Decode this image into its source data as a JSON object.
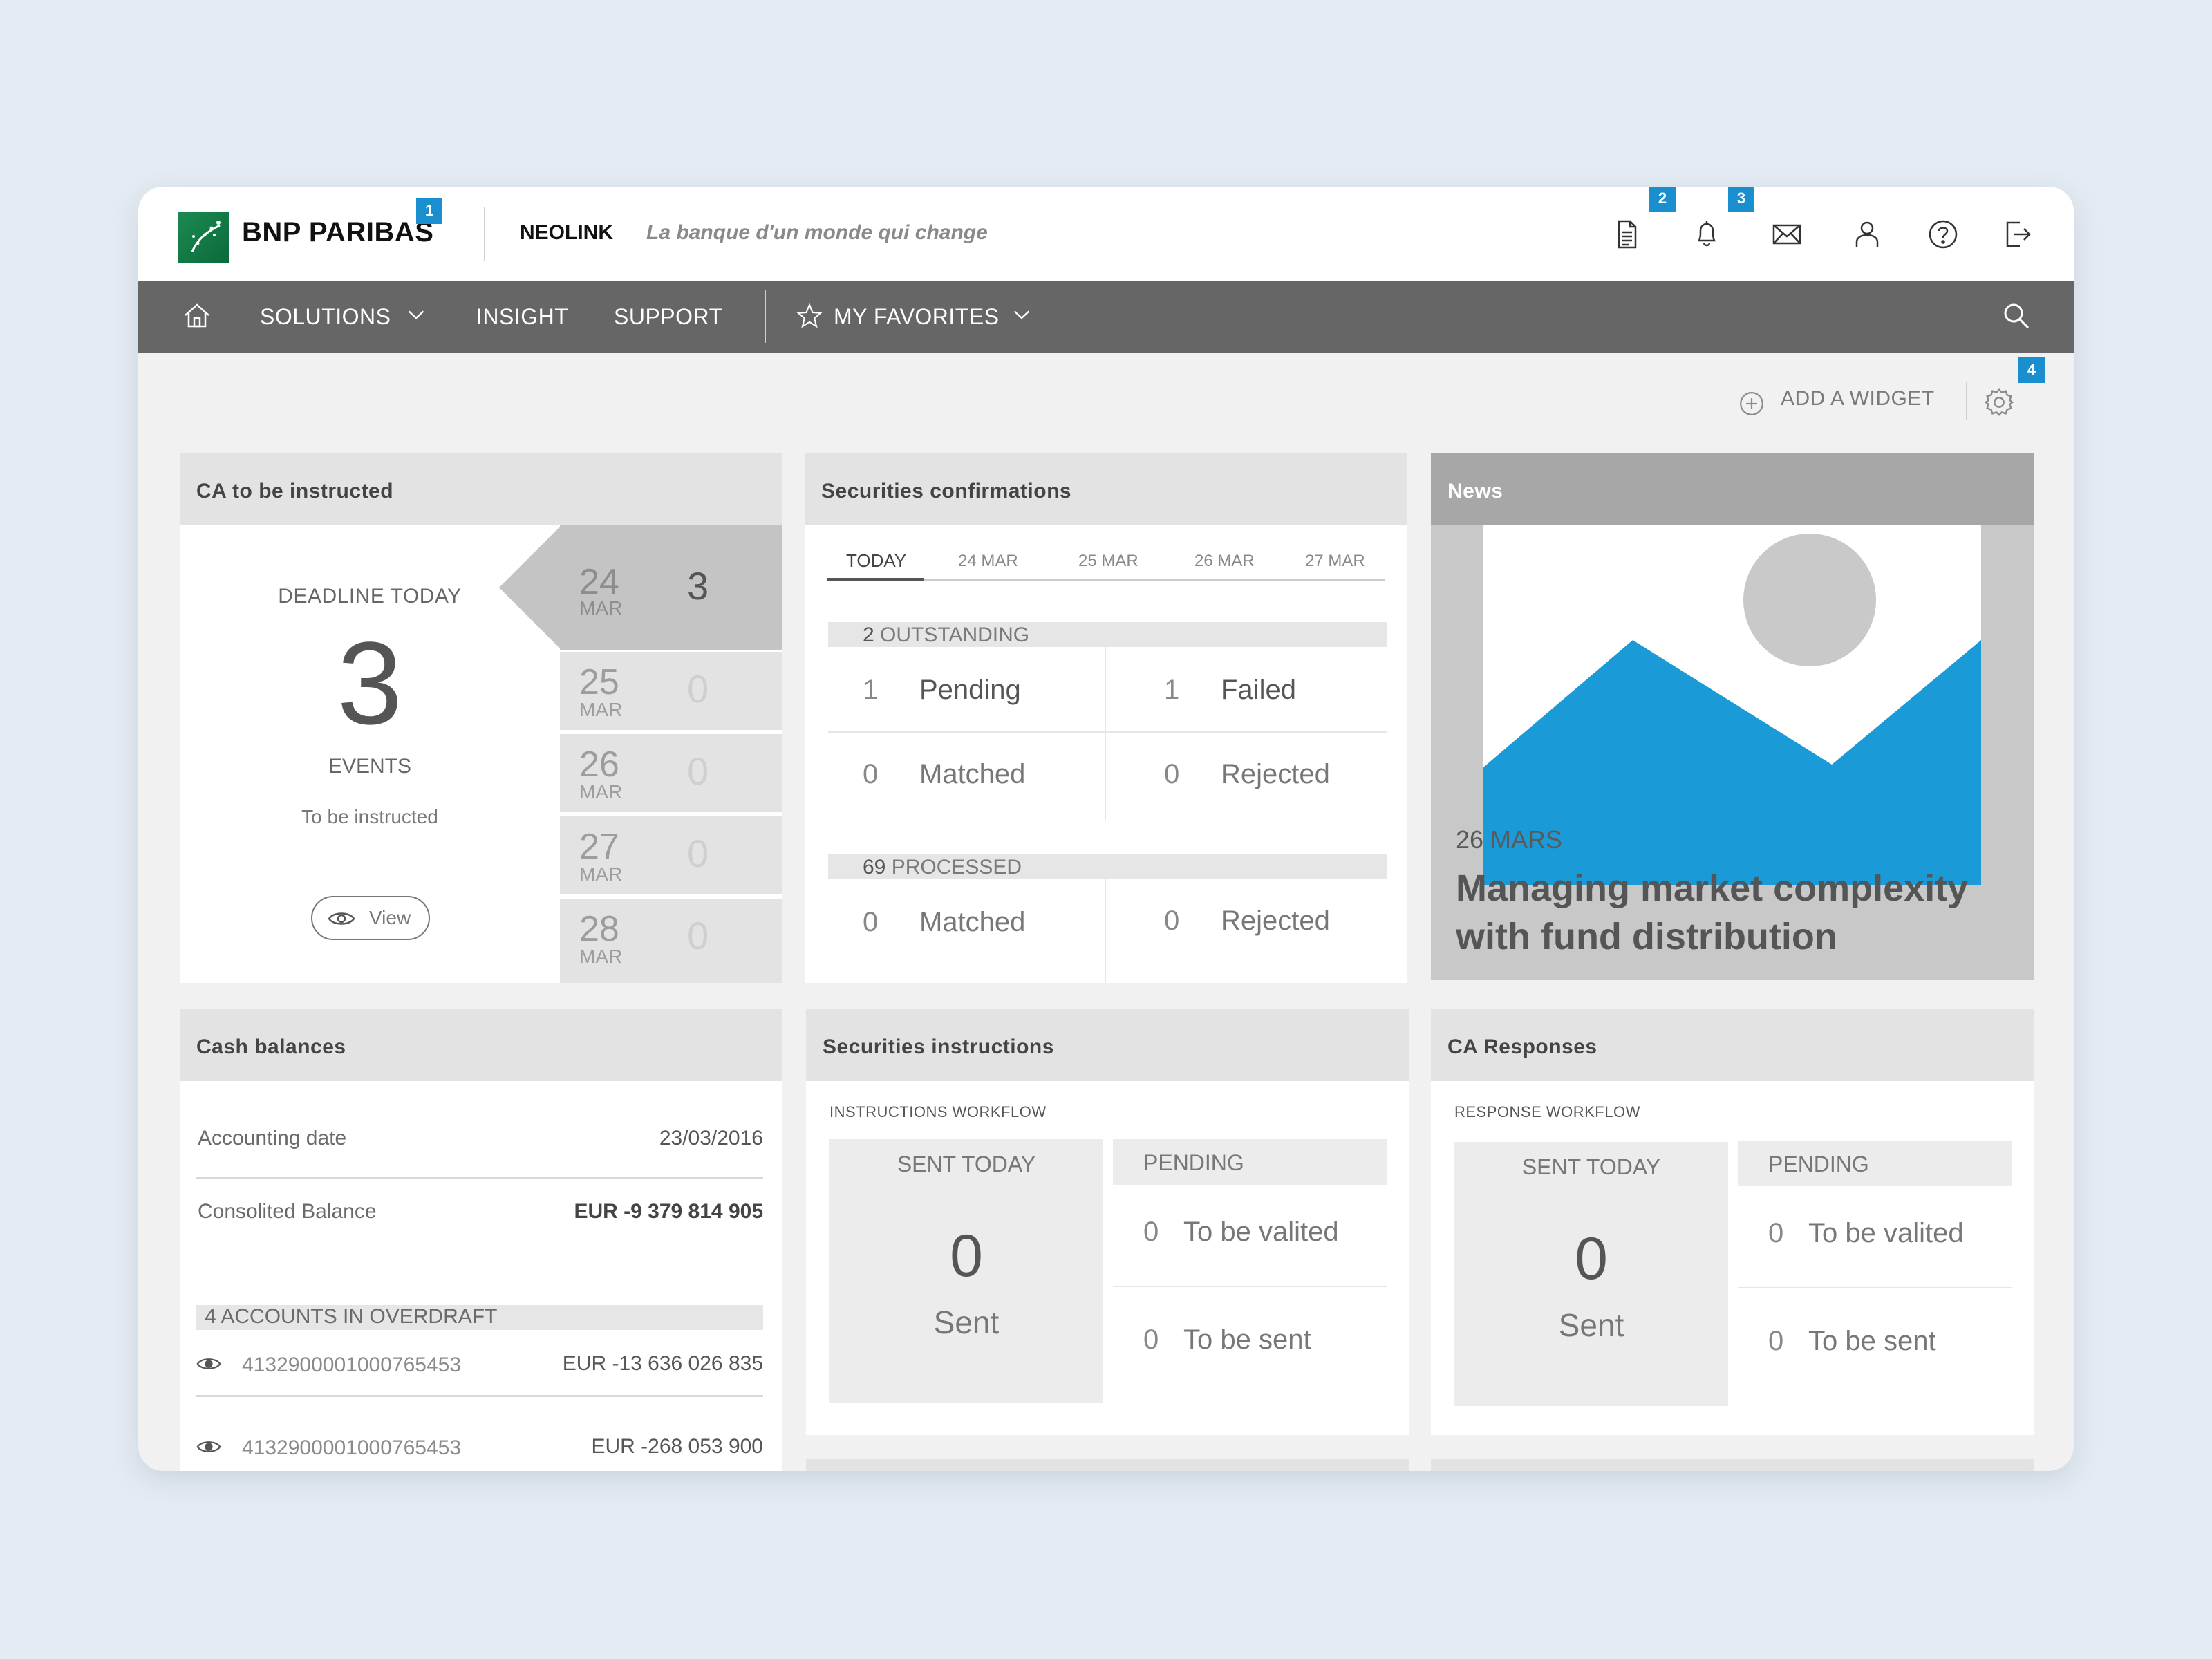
{
  "header": {
    "brand": "BNP PARIBAS",
    "app_name": "NEOLINK",
    "tagline": "La banque d'un monde qui change",
    "callouts": [
      "1",
      "2",
      "3",
      "4"
    ],
    "icons": [
      "document-icon",
      "bell-icon",
      "mail-icon",
      "user-icon",
      "help-icon",
      "logout-icon"
    ]
  },
  "nav": {
    "solutions": "SOLUTIONS",
    "insight": "INSIGHT",
    "support": "SUPPORT",
    "favorites": "MY FAVORITES"
  },
  "toolbar": {
    "add_widget": "ADD A WIDGET"
  },
  "ca_instructed": {
    "title": "CA to be instructed",
    "deadline_label": "DEADLINE TODAY",
    "count": "3",
    "events_label": "EVENTS",
    "subtitle": "To be instructed",
    "view_label": "View",
    "days": [
      {
        "day": "24",
        "month": "MAR",
        "count": "3"
      },
      {
        "day": "25",
        "month": "MAR",
        "count": "0"
      },
      {
        "day": "26",
        "month": "MAR",
        "count": "0"
      },
      {
        "day": "27",
        "month": "MAR",
        "count": "0"
      },
      {
        "day": "28",
        "month": "MAR",
        "count": "0"
      }
    ]
  },
  "sec_confirmations": {
    "title": "Securities confirmations",
    "tabs": [
      "TODAY",
      "24 MAR",
      "25 MAR",
      "26 MAR",
      "27 MAR"
    ],
    "outstanding": {
      "count": "2",
      "label": "OUTSTANDING"
    },
    "pending": {
      "n": "1",
      "label": "Pending"
    },
    "failed": {
      "n": "1",
      "label": "Failed"
    },
    "matched": {
      "n": "0",
      "label": "Matched"
    },
    "rejected": {
      "n": "0",
      "label": "Rejected"
    },
    "processed": {
      "count": "69",
      "label": "PROCESSED"
    },
    "p_matched": {
      "n": "0",
      "label": "Matched"
    },
    "p_rejected": {
      "n": "0",
      "label": "Rejected"
    }
  },
  "news": {
    "title": "News",
    "date": "26 MARS",
    "headline": "Managing market complexity with fund distribution",
    "progress": 0.34
  },
  "cash": {
    "title": "Cash balances",
    "accounting_label": "Accounting date",
    "accounting_date": "23/03/2016",
    "consolidated_label": "Consolited Balance",
    "consolidated_value": "EUR -9 379 814 905",
    "overdraft": {
      "count": "4",
      "label": "ACCOUNTS IN OVERDRAFT"
    },
    "accounts": [
      {
        "number": "4132900001000765453",
        "amount": "EUR -13 636 026 835"
      },
      {
        "number": "4132900001000765453",
        "amount": "EUR -268 053 900"
      }
    ]
  },
  "sec_instructions": {
    "title": "Securities instructions",
    "workflow": "INSTRUCTIONS WORKFLOW",
    "sent_today": "SENT TODAY",
    "sent_count": "0",
    "sent_label": "Sent",
    "pending": "PENDING",
    "row1": {
      "n": "0",
      "label": "To be valited"
    },
    "row2": {
      "n": "0",
      "label": "To be sent"
    }
  },
  "ca_responses": {
    "title": "CA Responses",
    "workflow": "RESPONSE WORKFLOW",
    "sent_today": "SENT TODAY",
    "sent_count": "0",
    "sent_label": "Sent",
    "pending": "PENDING",
    "row1": {
      "n": "0",
      "label": "To be valited"
    },
    "row2": {
      "n": "0",
      "label": "To be sent"
    }
  },
  "colors": {
    "accent": "#1a8fd0",
    "nav": "#666666",
    "logo": "#1b8a52"
  }
}
